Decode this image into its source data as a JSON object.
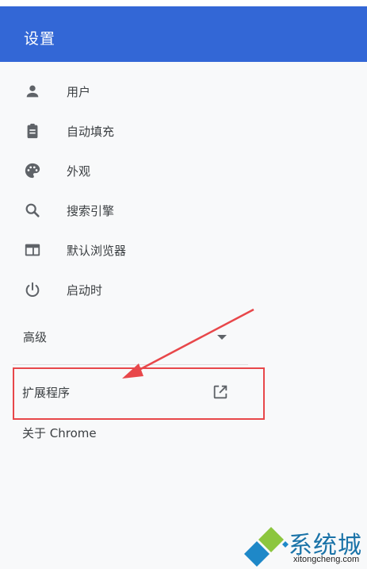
{
  "header": {
    "title": "设置"
  },
  "nav": {
    "items": [
      {
        "label": "用户",
        "icon": "person-icon"
      },
      {
        "label": "自动填充",
        "icon": "clipboard-icon"
      },
      {
        "label": "外观",
        "icon": "palette-icon"
      },
      {
        "label": "搜索引擎",
        "icon": "search-icon"
      },
      {
        "label": "默认浏览器",
        "icon": "browser-window-icon"
      },
      {
        "label": "启动时",
        "icon": "power-icon"
      }
    ],
    "advanced_label": "高级",
    "extensions_label": "扩展程序",
    "about_label": "关于 Chrome"
  },
  "watermark": {
    "text": "系统城",
    "url": "xitongcheng.com"
  },
  "colors": {
    "header": "#3367d6",
    "highlight": "#e8474a",
    "icon": "#5f6368"
  }
}
